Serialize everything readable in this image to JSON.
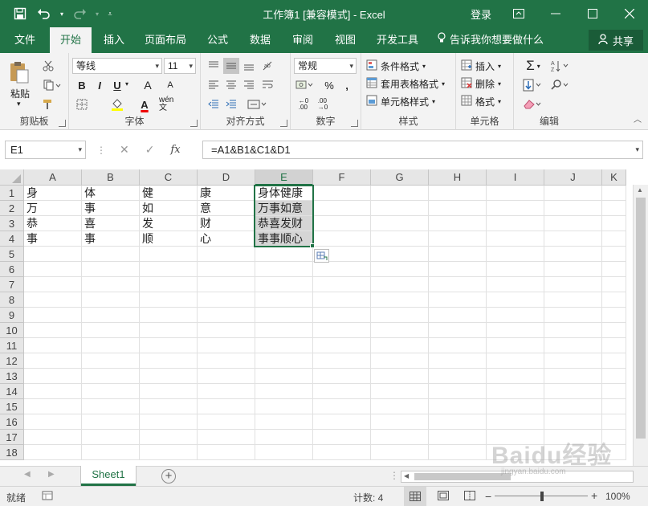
{
  "window": {
    "title": "工作簿1 [兼容模式] - Excel",
    "login": "登录"
  },
  "tabs": [
    {
      "label": "文件",
      "active": false
    },
    {
      "label": "开始",
      "active": true
    },
    {
      "label": "插入",
      "active": false
    },
    {
      "label": "页面布局",
      "active": false
    },
    {
      "label": "公式",
      "active": false
    },
    {
      "label": "数据",
      "active": false
    },
    {
      "label": "审阅",
      "active": false
    },
    {
      "label": "视图",
      "active": false
    },
    {
      "label": "开发工具",
      "active": false
    }
  ],
  "tell_me": "告诉我你想要做什么",
  "share_label": "共享",
  "ribbon": {
    "clipboard": {
      "label": "剪贴板",
      "paste": "粘贴"
    },
    "font": {
      "label": "字体",
      "family": "等线",
      "size": "11",
      "bold": "B",
      "italic": "I",
      "underline": "U",
      "grow": "A",
      "shrink": "A",
      "wen": "wén"
    },
    "alignment": {
      "label": "对齐方式"
    },
    "number": {
      "label": "数字",
      "format": "常规",
      "percent": "%",
      "comma": ","
    },
    "styles": {
      "label": "样式",
      "conditional": "条件格式",
      "table": "套用表格格式",
      "cell_styles": "单元格样式"
    },
    "cells": {
      "label": "单元格",
      "insert": "插入",
      "delete": "删除",
      "format": "格式"
    },
    "editing": {
      "label": "编辑"
    }
  },
  "formula_bar": {
    "name_box": "E1",
    "fx": "fx",
    "formula": "=A1&B1&C1&D1"
  },
  "columns": [
    "A",
    "B",
    "C",
    "D",
    "E",
    "F",
    "G",
    "H",
    "I",
    "J",
    "K"
  ],
  "selected_column": "E",
  "rows": [
    "1",
    "2",
    "3",
    "4",
    "5",
    "6",
    "7",
    "8",
    "9",
    "10",
    "11",
    "12",
    "13",
    "14",
    "15",
    "16",
    "17",
    "18"
  ],
  "cells": [
    [
      "身",
      "体",
      "健",
      "康",
      "身体健康"
    ],
    [
      "万",
      "事",
      "如",
      "意",
      "万事如意"
    ],
    [
      "恭",
      "喜",
      "发",
      "财",
      "恭喜发财"
    ],
    [
      "事",
      "事",
      "顺",
      "心",
      "事事顺心"
    ]
  ],
  "sheet_tab": "Sheet1",
  "status": {
    "ready": "就绪",
    "count": "计数: 4",
    "zoom": "100%"
  },
  "watermark": {
    "text": "Baidu经验",
    "sub": "jingyan.baidu.com"
  },
  "colors": {
    "accent": "#217346",
    "selection_fill": "#d5d5d5"
  }
}
